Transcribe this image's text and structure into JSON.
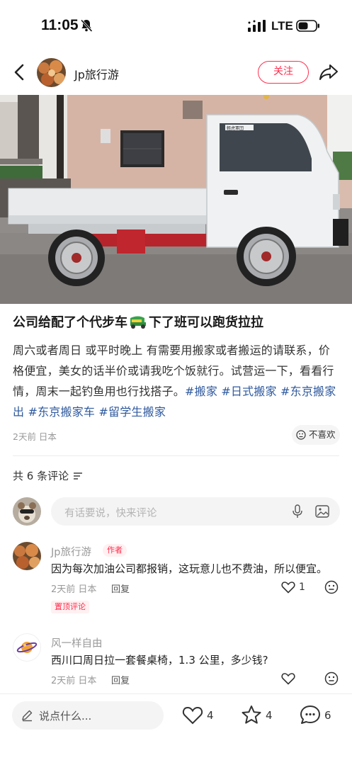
{
  "status_bar": {
    "time": "11:05",
    "network": "LTE",
    "icons": [
      "bell-muted-icon",
      "signal-icon",
      "battery-icon"
    ]
  },
  "header": {
    "author_name": "Jp旅行游",
    "follow_label": "关注",
    "icons": [
      "back-icon",
      "share-icon"
    ]
  },
  "photo": {
    "truck_door_text": "軽虎軍団"
  },
  "post": {
    "title_before": "公司给配了个代步车",
    "title_after": "下了班可以跑货拉拉",
    "body": "周六或者周日 或平时晚上 有需要用搬家或者搬运的请联系，价格便宜，美女的话半价或请我吃个饭就行。试营运一下，看看行情，周末一起钓鱼用也行找搭子。",
    "hashtags": [
      "#搬家",
      "#日式搬家",
      "#东京搬家出",
      "#东京搬家车",
      "#留学生搬家"
    ],
    "meta": "2天前 日本",
    "dislike_label": "不喜欢"
  },
  "comments_section": {
    "count_label": "共 6 条评论",
    "input_placeholder": "有话要说，快来评论",
    "comments": [
      {
        "name": "Jp旅行游",
        "tag": "作者",
        "text": "因为每次加油公司都报销，这玩意儿也不费油，所以便宜。",
        "meta": "2天前 日本",
        "reply": "回复",
        "likes": "1",
        "pin_label": "置顶评论"
      },
      {
        "name": "风一样自由",
        "text": "西川口周日拉一套餐桌椅，1.3 公里，多少钱?",
        "meta": "2天前 日本",
        "reply": "回复"
      }
    ]
  },
  "bottom_bar": {
    "input_placeholder": "说点什么...",
    "likes": "4",
    "collects": "4",
    "comments": "6"
  },
  "colors": {
    "accent": "#ff2e4d",
    "hashtag": "#2f5a9e"
  }
}
